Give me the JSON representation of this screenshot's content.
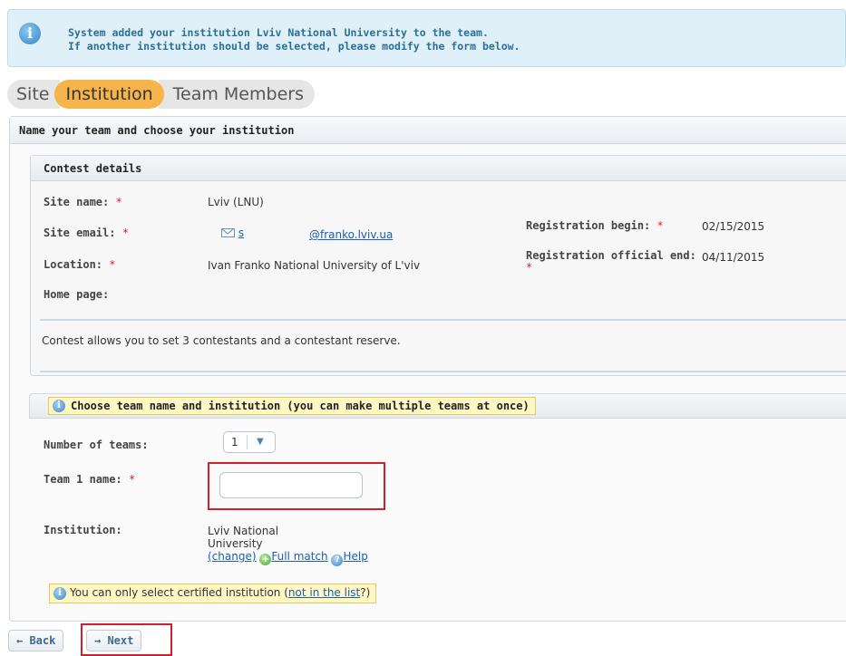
{
  "banner": {
    "icon": "info-icon",
    "line1": "System added your institution Lviv National University to the team.",
    "line2": "If another institution should be selected, please modify the form below."
  },
  "tabs": [
    {
      "label": "Site",
      "active": false
    },
    {
      "label": "Institution",
      "active": true
    },
    {
      "label": "Team Members",
      "active": false
    }
  ],
  "panel": {
    "title": "Name your team and choose your institution"
  },
  "details": {
    "title": "Contest details",
    "site_name_label": "Site name:",
    "site_name_value": "Lviv (LNU)",
    "site_email_label": "Site email:",
    "site_email_user": "s",
    "site_email_domain": "@franko.lviv.ua",
    "location_label": "Location:",
    "location_value": "Ivan Franko National University of L'viv",
    "home_page_label": "Home page:",
    "reg_begin_label": "Registration begin:",
    "reg_begin_value": "02/15/2015",
    "reg_end_label": "Registration official end:",
    "reg_end_value": "04/11/2015",
    "contestants_note": "Contest allows you to set 3 contestants and a contestant reserve.",
    "required_mark": "*"
  },
  "choose": {
    "title": "Choose team name and institution (you can make multiple teams at once)",
    "num_teams_label": "Number of teams:",
    "num_teams_value": "1",
    "team1_label": "Team 1 name:",
    "team1_value": "",
    "institution_label": "Institution:",
    "institution_line1": "Lviv National",
    "institution_line2": "University",
    "change_link": "(change)",
    "full_match": "Full match",
    "help": "Help",
    "notice_prefix": "You can only select certified institution (",
    "notice_link": "not in the list",
    "notice_suffix": "?)"
  },
  "buttons": {
    "back": "← Back",
    "next": "→ Next"
  },
  "colors": {
    "active_tab": "#f5b54a",
    "highlight_border": "#d21f2b",
    "banner_text": "#2b6f96"
  }
}
